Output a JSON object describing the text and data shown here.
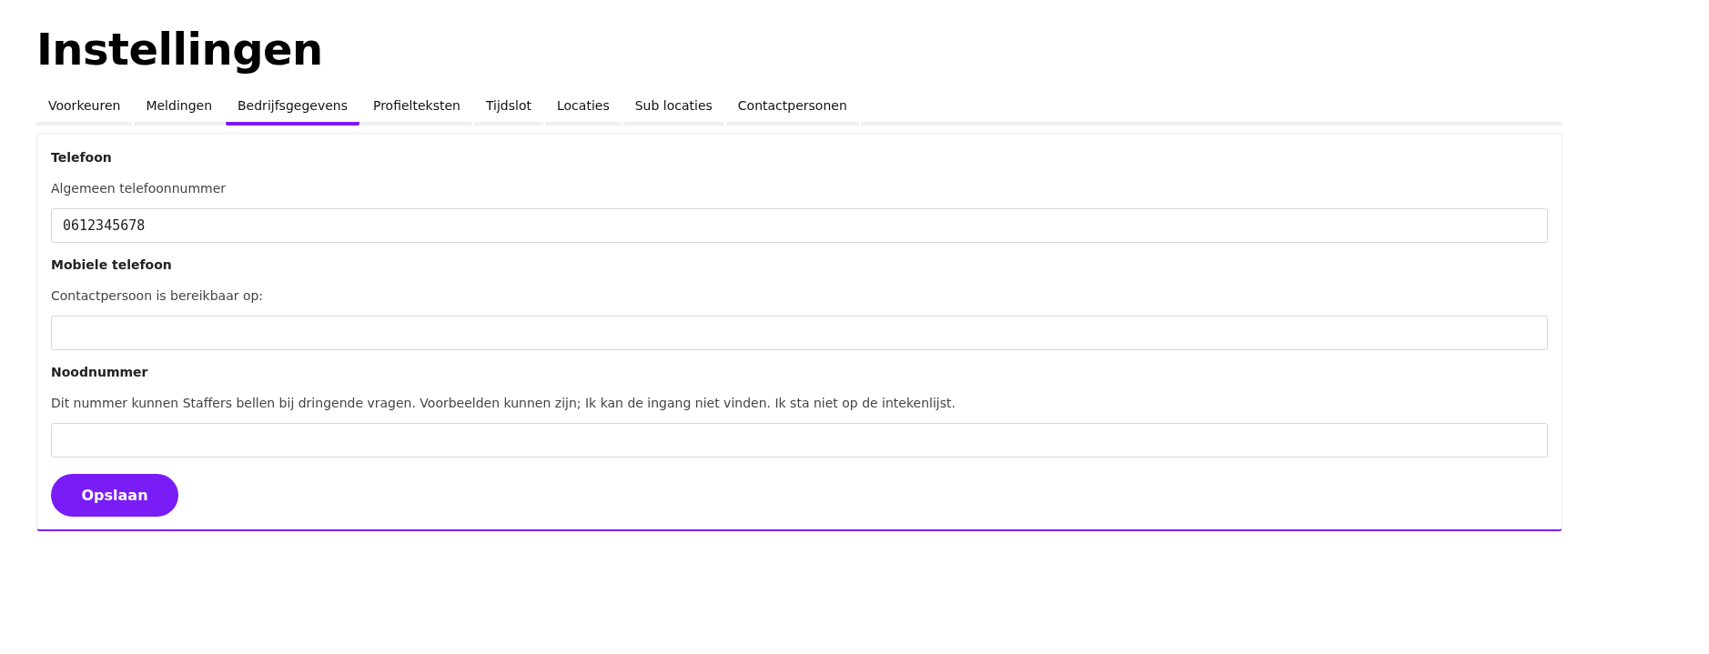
{
  "page": {
    "title": "Instellingen"
  },
  "tabs": [
    {
      "label": "Voorkeuren",
      "selected": false
    },
    {
      "label": "Meldingen",
      "selected": false
    },
    {
      "label": "Bedrijfsgegevens",
      "selected": true
    },
    {
      "label": "Profielteksten",
      "selected": false
    },
    {
      "label": "Tijdslot",
      "selected": false
    },
    {
      "label": "Locaties",
      "selected": false
    },
    {
      "label": "Sub locaties",
      "selected": false
    },
    {
      "label": "Contactpersonen",
      "selected": false
    }
  ],
  "sections": [
    {
      "heading": "Telefoon",
      "label": "Algemeen telefoonnummer",
      "value": "0612345678"
    },
    {
      "heading": "Mobiele telefoon",
      "label": "Contactpersoon is bereikbaar op:"
    },
    {
      "heading": "Noodnummer",
      "label": "Dit nummer kunnen Staffers bellen bij dringende vragen. Voorbeelden kunnen zijn; Ik kan de ingang niet vinden. Ik sta niet op de intekenlijst."
    }
  ],
  "save_button": {
    "label": "Opslaan"
  }
}
